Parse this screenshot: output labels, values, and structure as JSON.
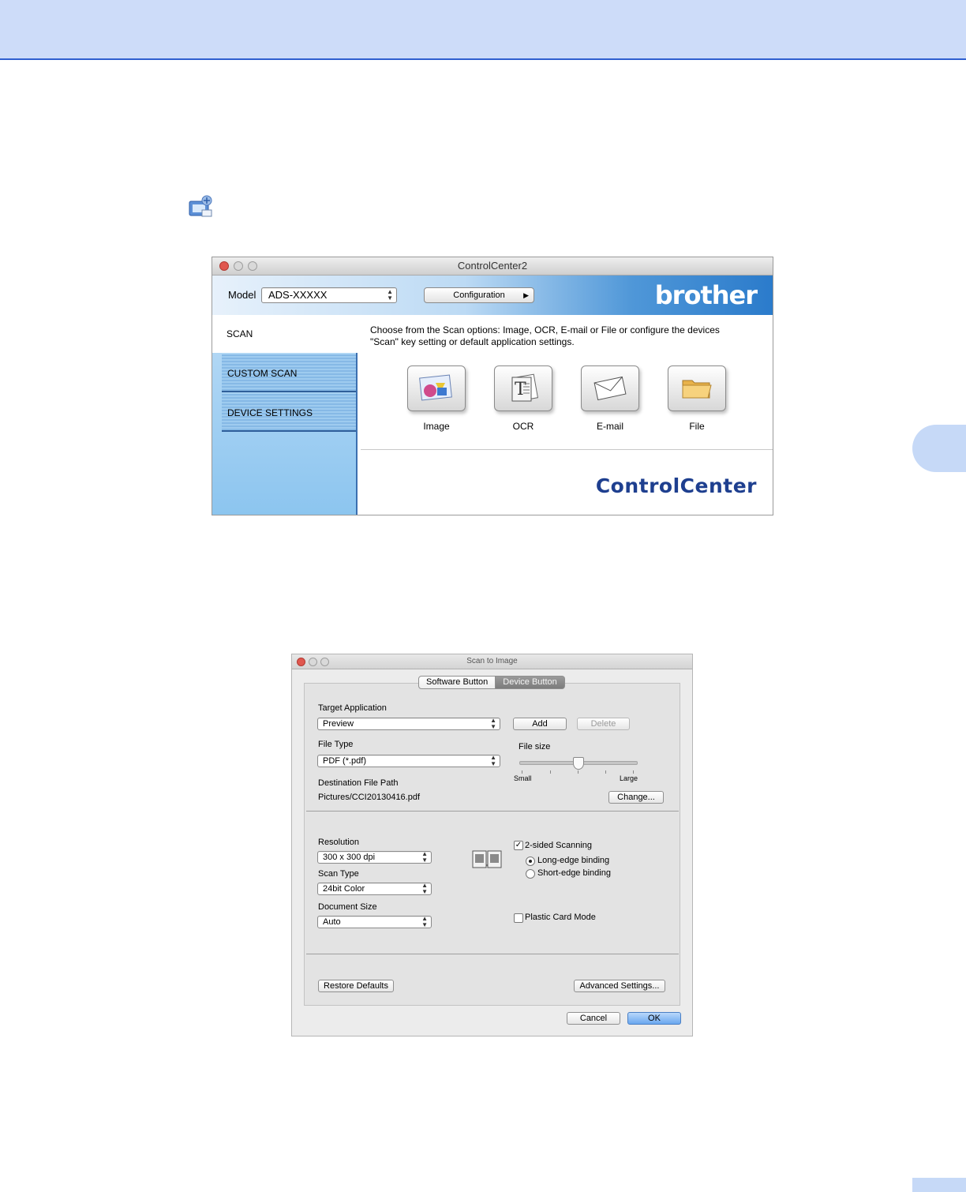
{
  "controlcenter": {
    "title": "ControlCenter2",
    "model_label": "Model",
    "model_value": "ADS-XXXXX",
    "configuration_label": "Configuration",
    "brand": "brother",
    "nav": [
      {
        "label": "SCAN",
        "active": true
      },
      {
        "label": "CUSTOM SCAN",
        "active": false
      },
      {
        "label": "DEVICE SETTINGS",
        "active": false
      }
    ],
    "description_line1": "Choose from the Scan options: Image, OCR, E-mail or File or configure the devices",
    "description_line2": "\"Scan\" key setting or default application settings.",
    "tiles": [
      {
        "label": "Image",
        "icon": "image-icon"
      },
      {
        "label": "OCR",
        "icon": "ocr-icon"
      },
      {
        "label": "E-mail",
        "icon": "envelope-icon"
      },
      {
        "label": "File",
        "icon": "folder-icon"
      }
    ],
    "wordmark": "ControlCenter"
  },
  "dialog": {
    "title": "Scan to Image",
    "tabs": [
      {
        "label": "Software Button",
        "selected": false
      },
      {
        "label": "Device Button",
        "selected": true
      }
    ],
    "target_application_label": "Target Application",
    "target_application_value": "Preview",
    "add_label": "Add",
    "delete_label": "Delete",
    "file_type_label": "File Type",
    "file_type_value": "PDF (*.pdf)",
    "file_size_label": "File size",
    "file_size_small": "Small",
    "file_size_large": "Large",
    "file_size_position": 0.5,
    "destination_label": "Destination File Path",
    "destination_value": "Pictures/CCI20130416.pdf",
    "change_label": "Change...",
    "resolution_label": "Resolution",
    "resolution_value": "300 x 300 dpi",
    "scan_type_label": "Scan Type",
    "scan_type_value": "24bit Color",
    "document_size_label": "Document Size",
    "document_size_value": "Auto",
    "two_sided_label": "2-sided Scanning",
    "two_sided_checked": true,
    "long_edge_label": "Long-edge binding",
    "short_edge_label": "Short-edge binding",
    "binding_selected": "long-edge",
    "plastic_card_label": "Plastic Card Mode",
    "plastic_card_checked": false,
    "restore_defaults_label": "Restore Defaults",
    "advanced_settings_label": "Advanced Settings...",
    "cancel_label": "Cancel",
    "ok_label": "OK"
  },
  "colors": {
    "header_band": "#cddcf9",
    "header_rule": "#2f5fd0",
    "brand_blue": "#1e3f8f",
    "default_button": "#6aa7ef"
  }
}
